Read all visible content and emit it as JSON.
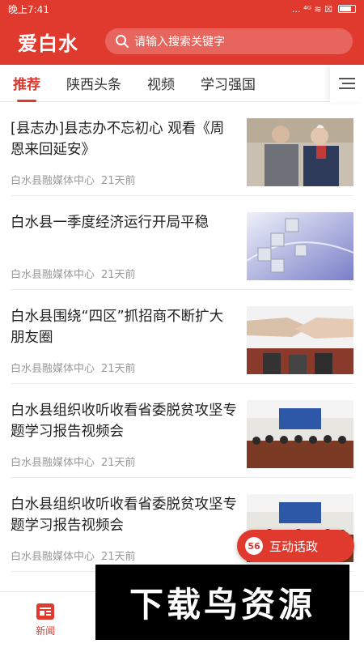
{
  "status_bar": {
    "time": "晚上7:41",
    "icons": "… ⁴ᴳ ≋ ☒"
  },
  "header": {
    "logo": "爱白水",
    "search_placeholder": "请输入搜索关键字"
  },
  "tabs": [
    {
      "label": "推荐",
      "active": true
    },
    {
      "label": "陕西头条",
      "active": false
    },
    {
      "label": "视频",
      "active": false
    },
    {
      "label": "学习强国",
      "active": false
    }
  ],
  "feed": [
    {
      "title": "[县志办]县志办不忘初心 观看《周恩来回延安》",
      "source": "白水县融媒体中心",
      "time": "21天前",
      "thumb": "portrait-photo"
    },
    {
      "title": "白水县一季度经济运行开局平稳",
      "source": "白水县融媒体中心",
      "time": "21天前",
      "thumb": "cubes-graphic"
    },
    {
      "title": "白水县围绕“四区”抓招商不断扩大朋友圈",
      "source": "白水县融媒体中心",
      "time": "21天前",
      "thumb": "handshake-photo"
    },
    {
      "title": "白水县组织收听收看省委脱贫攻坚专题学习报告视频会",
      "source": "白水县融媒体中心",
      "time": "21天前",
      "thumb": "meeting-photo"
    },
    {
      "title": "白水县组织收听收看省委脱贫攻坚专题学习报告视频会",
      "source": "白水县融媒体中心",
      "time": "21天前",
      "thumb": "meeting-photo"
    }
  ],
  "float_button": {
    "label": "互动话政",
    "icon": "56"
  },
  "bottom_nav": [
    {
      "label": "新闻",
      "active": true
    },
    {
      "label": "",
      "active": false
    },
    {
      "label": "",
      "active": false
    },
    {
      "label": "",
      "active": false
    }
  ],
  "watermark": "下载鸟资源",
  "colors": {
    "brand": "#e03a2f"
  }
}
